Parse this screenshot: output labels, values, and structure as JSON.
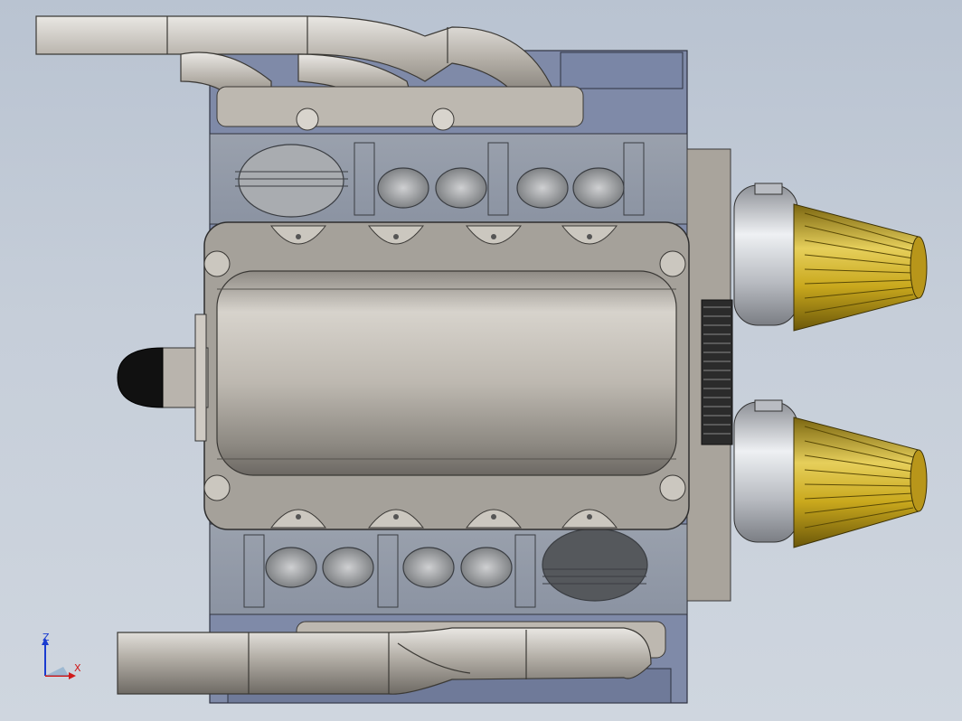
{
  "viewport": {
    "background_top": "#b9c3d1",
    "background_bottom": "#cfd6df"
  },
  "model": {
    "description_icon": "v8-engine-model",
    "block_color": "#7f8aa8",
    "metal_color": "#c9c6c0",
    "filter_color": "#c9a81d",
    "pulley_color": "#d0d2d6"
  },
  "triad": {
    "z_label": "Z",
    "x_label": "X",
    "z_color": "#1a3bd0",
    "x_color": "#d01a1a"
  }
}
